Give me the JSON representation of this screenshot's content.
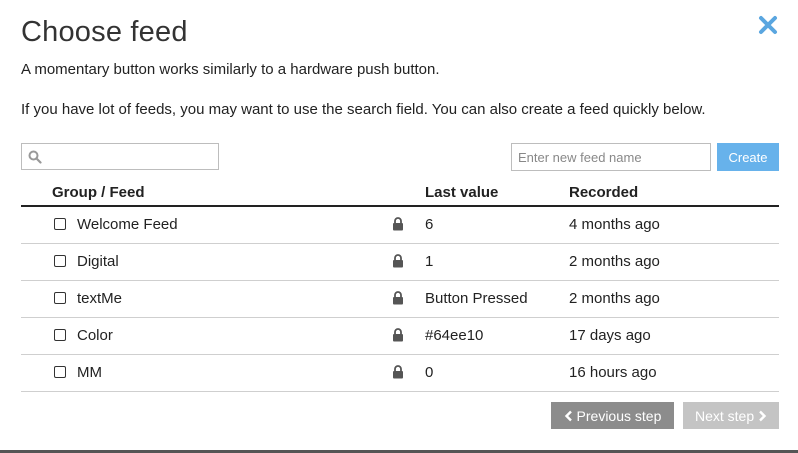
{
  "dialog": {
    "title": "Choose feed",
    "description": "A momentary button works similarly to a hardware push button.",
    "hint": "If you have lot of feeds, you may want to use the search field. You can also create a feed quickly below."
  },
  "search": {
    "placeholder": "",
    "value": ""
  },
  "create": {
    "placeholder": "Enter new feed name",
    "button_label": "Create"
  },
  "table": {
    "columns": [
      "Group / Feed",
      "Last value",
      "Recorded"
    ],
    "rows": [
      {
        "name": "Welcome Feed",
        "last_value": "6",
        "recorded": "4 months ago"
      },
      {
        "name": "Digital",
        "last_value": "1",
        "recorded": "2 months ago"
      },
      {
        "name": "textMe",
        "last_value": "Button Pressed",
        "recorded": "2 months ago"
      },
      {
        "name": "Color",
        "last_value": "#64ee10",
        "recorded": "17 days ago"
      },
      {
        "name": "MM",
        "last_value": "0",
        "recorded": "16 hours ago"
      }
    ]
  },
  "footer": {
    "prev_label": "Previous step",
    "next_label": "Next step"
  },
  "icons": {
    "close": "close-icon",
    "search": "search-icon",
    "lock": "lock-icon",
    "prev": "chevron-left-icon",
    "next": "chevron-right-icon"
  },
  "colors": {
    "accent": "#67b2eb",
    "close": "#5aa6e0",
    "prev_button": "#8c8c8c",
    "next_button_disabled": "#c4c4c4"
  }
}
